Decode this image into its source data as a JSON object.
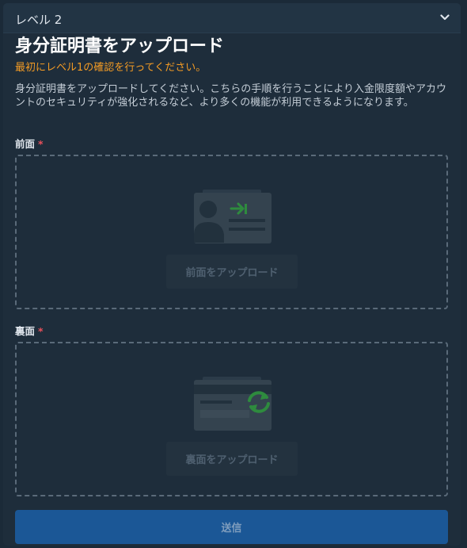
{
  "header": {
    "title": "レベル 2",
    "chevron_icon": "chevron-down-icon"
  },
  "main": {
    "title": "身分証明書をアップロード",
    "warning": "最初にレベル1の確認を行ってください。",
    "description": "身分証明書をアップロードしてください。こちらの手順を行うことにより入金限度額やアカウントのセキュリティが強化されるなど、より多くの機能が利用できるようになります。"
  },
  "front": {
    "label": "前面",
    "required_mark": "*",
    "icon": "id-card-front-icon",
    "button_label": "前面をアップロード"
  },
  "back": {
    "label": "裏面",
    "required_mark": "*",
    "icon": "id-card-back-icon",
    "button_label": "裏面をアップロード"
  },
  "submit": {
    "label": "送信"
  },
  "colors": {
    "background": "#1e2d3b",
    "accent_orange": "#f39b24",
    "required_red": "#e8505b",
    "primary_blue": "#1b5796",
    "icon_green": "#2e8b3e"
  }
}
